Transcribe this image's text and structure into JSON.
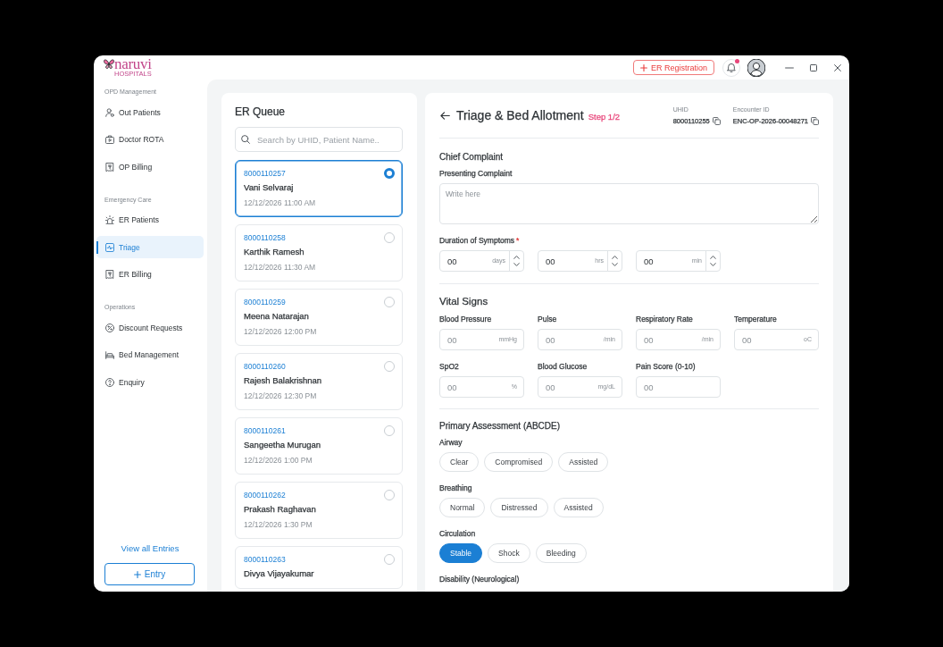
{
  "header": {
    "logo": {
      "name": "naruvi",
      "tagline": "HOSPITALS"
    },
    "action_button": {
      "label": "ER Registration"
    },
    "notifications": {
      "unread": true
    }
  },
  "sidebar": {
    "sections": [
      {
        "title": "OPD Management",
        "items": [
          {
            "label": "Out Patients",
            "selected": false
          },
          {
            "label": "Doctor ROTA",
            "selected": false
          },
          {
            "label": "OP Billing",
            "selected": false
          }
        ]
      },
      {
        "title": "Emergency Care",
        "items": [
          {
            "label": "ER Patients",
            "selected": false
          },
          {
            "label": "Triage",
            "selected": true
          },
          {
            "label": "ER Billing",
            "selected": false
          }
        ]
      },
      {
        "title": "Operations",
        "items": [
          {
            "label": "Discount Requests",
            "selected": false
          },
          {
            "label": "Bed Management",
            "selected": false
          },
          {
            "label": "Enquiry",
            "selected": false
          }
        ]
      }
    ],
    "link": "View all Entries",
    "button": "Entry"
  },
  "er_queue": {
    "title": "ER Queue",
    "search": {
      "placeholder": "Search by UHID, Patient Name.."
    },
    "patients": [
      {
        "uhid": "8000110257",
        "name": "Vani Selvaraj",
        "time": "12/12/2026 11:00 AM",
        "selected": true
      },
      {
        "uhid": "8000110258",
        "name": "Karthik Ramesh",
        "time": "12/12/2026 11:30 AM",
        "selected": false
      },
      {
        "uhid": "8000110259",
        "name": "Meena Natarajan",
        "time": "12/12/2026 12:00 PM",
        "selected": false
      },
      {
        "uhid": "8000110260",
        "name": "Rajesh Balakrishnan",
        "time": "12/12/2026 12:30 PM",
        "selected": false
      },
      {
        "uhid": "8000110261",
        "name": "Sangeetha Murugan",
        "time": "12/12/2026 1:00 PM",
        "selected": false
      },
      {
        "uhid": "8000110262",
        "name": "Prakash Raghavan",
        "time": "12/12/2026 1:30 PM",
        "selected": false
      },
      {
        "uhid": "8000110263",
        "name": "Divya Vijayakumar",
        "selected": false
      }
    ]
  },
  "triage": {
    "title": "Triage & Bed Allotment",
    "step": "Step 1/2",
    "ids": [
      {
        "label": "UHID",
        "value": "8000110255"
      },
      {
        "label": "Encounter ID",
        "value": "ENC-OP-2026-00048271"
      }
    ],
    "chief_complaint": {
      "title": "Chief Complaint",
      "complaint": {
        "label": "Presenting Complaint",
        "placeholder": "Write here"
      },
      "duration": {
        "label": "Duration of Symptoms",
        "required_mark": "*",
        "fields": [
          {
            "value": "00",
            "unit": "days"
          },
          {
            "value": "00",
            "unit": "hrs"
          },
          {
            "value": "00",
            "unit": "min"
          }
        ]
      }
    },
    "vital_signs": {
      "title": "Vital Signs",
      "fields": [
        {
          "label": "Blood Pressure",
          "placeholder": "00",
          "unit": "mmHg"
        },
        {
          "label": "Pulse",
          "placeholder": "00",
          "unit": "/min"
        },
        {
          "label": "Respiratory Rate",
          "placeholder": "00",
          "unit": "/min"
        },
        {
          "label": "Temperature",
          "placeholder": "00",
          "unit": "oC"
        },
        {
          "label": "SpO2",
          "placeholder": "00",
          "unit": "%"
        },
        {
          "label": "Blood Glucose",
          "placeholder": "00",
          "unit": "mg/dL"
        },
        {
          "label": "Pain Score (0-10)",
          "placeholder": "00"
        }
      ]
    },
    "primary_assessment": {
      "title": "Primary Assessment (ABCDE)",
      "groups": [
        {
          "label": "Airway",
          "options": [
            {
              "label": "Clear",
              "selected": false
            },
            {
              "label": "Compromised",
              "selected": false
            },
            {
              "label": "Assisted",
              "selected": false
            }
          ]
        },
        {
          "label": "Breathing",
          "options": [
            {
              "label": "Normal",
              "selected": false
            },
            {
              "label": "Distressed",
              "selected": false
            },
            {
              "label": "Assisted",
              "selected": false
            }
          ]
        },
        {
          "label": "Circulation",
          "options": [
            {
              "label": "Stable",
              "selected": true
            },
            {
              "label": "Shock",
              "selected": false
            },
            {
              "label": "Bleeding",
              "selected": false
            }
          ]
        },
        {
          "label": "Disability (Neurological)"
        }
      ]
    }
  }
}
